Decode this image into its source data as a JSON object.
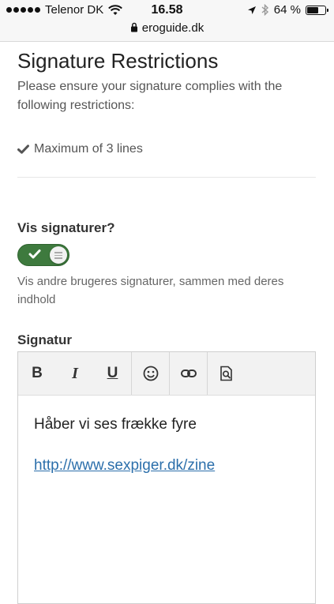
{
  "status_bar": {
    "carrier": "Telenor DK",
    "time": "16.58",
    "battery": "64 %",
    "battery_level": 0.64
  },
  "browser": {
    "url": "eroguide.dk"
  },
  "restrictions": {
    "title": "Signature Restrictions",
    "description": "Please ensure your signature complies with the following restrictions:",
    "items": [
      "Maximum of 3 lines"
    ]
  },
  "show_signatures": {
    "label": "Vis signaturer?",
    "enabled": true,
    "helper": "Vis andre brugeres signaturer, sammen med deres indhold"
  },
  "signature": {
    "label": "Signatur",
    "toolbar": {
      "bold": "B",
      "italic": "I",
      "underline": "U"
    },
    "body_line": "Håber vi ses frække fyre",
    "body_link": "http://www.sexpiger.dk/zine"
  },
  "colors": {
    "toggle_on": "#3e7a3e",
    "link": "#2c6fab"
  }
}
